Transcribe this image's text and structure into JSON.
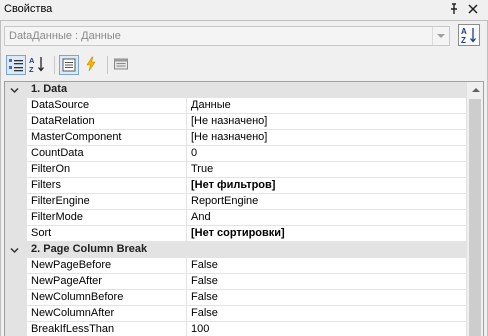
{
  "window": {
    "title": "Свойства"
  },
  "object_selector": {
    "value": "DataДанные : Данные"
  },
  "grid": {
    "categories": [
      {
        "label": "1. Data",
        "expanded": true,
        "properties": [
          {
            "name": "DataSource",
            "value": "Данные",
            "bold": false
          },
          {
            "name": "DataRelation",
            "value": "[Не назначено]",
            "bold": false
          },
          {
            "name": "MasterComponent",
            "value": "[Не назначено]",
            "bold": false
          },
          {
            "name": "CountData",
            "value": "0",
            "bold": false
          },
          {
            "name": "FilterOn",
            "value": "True",
            "bold": false
          },
          {
            "name": "Filters",
            "value": "[Нет фильтров]",
            "bold": true
          },
          {
            "name": "FilterEngine",
            "value": "ReportEngine",
            "bold": false
          },
          {
            "name": "FilterMode",
            "value": "And",
            "bold": false
          },
          {
            "name": "Sort",
            "value": "[Нет сортировки]",
            "bold": true
          }
        ]
      },
      {
        "label": "2. Page Column Break",
        "expanded": true,
        "properties": [
          {
            "name": "NewPageBefore",
            "value": "False",
            "bold": false
          },
          {
            "name": "NewPageAfter",
            "value": "False",
            "bold": false
          },
          {
            "name": "NewColumnBefore",
            "value": "False",
            "bold": false
          },
          {
            "name": "NewColumnAfter",
            "value": "False",
            "bold": false
          },
          {
            "name": "BreakIfLessThan",
            "value": "100",
            "bold": false
          }
        ]
      }
    ]
  },
  "colors": {
    "panel_bg": "#f0f0f0",
    "category_bg": "#e3e3e3",
    "grid_line": "#e3e3e3",
    "toolbar_active_border": "#7fa6d2",
    "toolbar_active_bg": "#dce9f7",
    "lightning_yellow": "#f7b500"
  }
}
